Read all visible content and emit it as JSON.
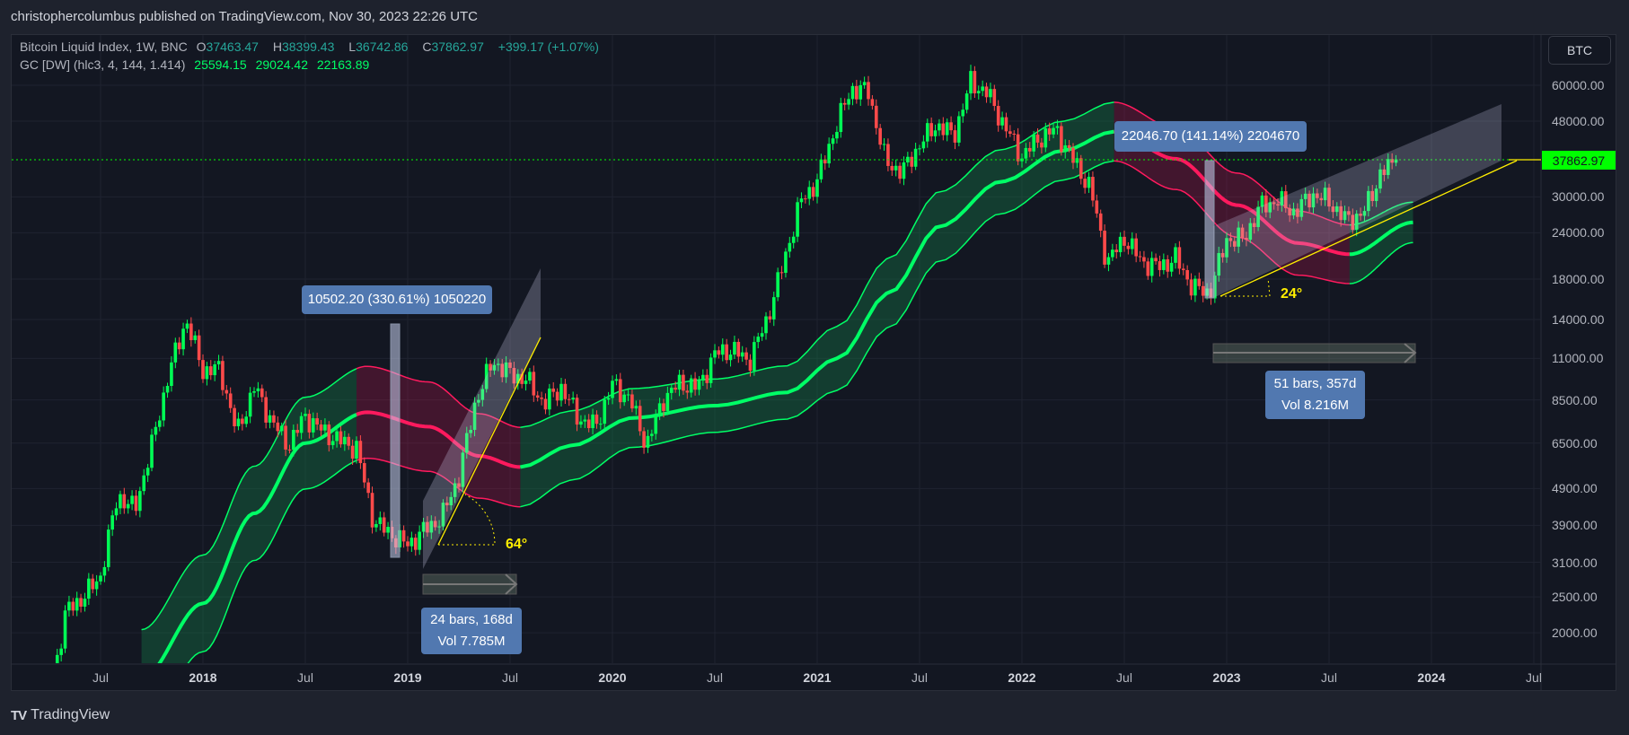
{
  "header": {
    "title": "christophercolumbus published on TradingView.com, Nov 30, 2023 22:26 UTC"
  },
  "legend": {
    "symbol": "Bitcoin Liquid Index, 1W, BNC",
    "open_label": "O",
    "open": "37463.47",
    "high_label": "H",
    "high": "38399.43",
    "low_label": "L",
    "low": "36742.86",
    "close_label": "C",
    "close": "37862.97",
    "change": "+399.17 (+1.07%)",
    "indicator": "GC [DW] (hlc3, 4, 144, 1.414)",
    "ind_values": [
      "25594.15",
      "29024.42",
      "22163.89"
    ]
  },
  "currency_button": "BTC",
  "last_price": "37862.97",
  "footer": {
    "logo": "TV",
    "brand": "TradingView"
  },
  "annotations": {
    "range1_label": "10502.20 (330.61%) 1050220",
    "range2_label": "22046.70 (141.14%) 2204670",
    "date1_bars": "24 bars, 168d",
    "date1_vol": "Vol 7.785M",
    "date2_bars": "51 bars, 357d",
    "date2_vol": "Vol 8.216M",
    "angle1": "64°",
    "angle2": "24°"
  },
  "colors": {
    "up": "#00ff55",
    "down": "#ff4a4a",
    "band_up": "#00ff66",
    "band_down": "#ff1a5e",
    "bg": "#131722"
  },
  "chart_data": {
    "type": "candlestick",
    "title": "Bitcoin Liquid Index, 1W, BNC",
    "y_scale": "log",
    "y_ticks": [
      "60000.00",
      "48000.00",
      "30000.00",
      "24000.00",
      "18000.00",
      "14000.00",
      "11000.00",
      "8500.00",
      "6500.00",
      "4900.00",
      "3900.00",
      "3100.00",
      "2500.00",
      "2000.00"
    ],
    "y_tick_values": [
      60000,
      48000,
      30000,
      24000,
      18000,
      14000,
      11000,
      8500,
      6500,
      4900,
      3900,
      3100,
      2500,
      2000
    ],
    "x_ticks": [
      {
        "t": 2017.5,
        "label": "Jul"
      },
      {
        "t": 2018,
        "label": "2018"
      },
      {
        "t": 2018.5,
        "label": "Jul"
      },
      {
        "t": 2019,
        "label": "2019"
      },
      {
        "t": 2019.5,
        "label": "Jul"
      },
      {
        "t": 2020,
        "label": "2020"
      },
      {
        "t": 2020.5,
        "label": "Jul"
      },
      {
        "t": 2021,
        "label": "2021"
      },
      {
        "t": 2021.5,
        "label": "Jul"
      },
      {
        "t": 2022,
        "label": "2022"
      },
      {
        "t": 2022.5,
        "label": "Jul"
      },
      {
        "t": 2023,
        "label": "2023"
      },
      {
        "t": 2023.5,
        "label": "Jul"
      },
      {
        "t": 2024,
        "label": "2024"
      },
      {
        "t": 2024.5,
        "label": "Jul"
      }
    ],
    "monthly_close_start": 2017.25,
    "monthly_closes": [
      1350,
      2300,
      2500,
      2850,
      4700,
      4300,
      6400,
      10000,
      14000,
      10200,
      10300,
      6900,
      9200,
      7500,
      6400,
      7700,
      7000,
      6600,
      6300,
      4000,
      3700,
      3450,
      3800,
      4100,
      5300,
      8500,
      10800,
      10000,
      9600,
      8300,
      9200,
      7600,
      7200,
      9350,
      8600,
      6400,
      8600,
      9450,
      9150,
      11300,
      11650,
      10800,
      13800,
      19700,
      29000,
      33100,
      45200,
      58800,
      57700,
      37300,
      35000,
      41500,
      47100,
      43800,
      61300,
      57000,
      46300,
      38500,
      43200,
      45500,
      37700,
      31800,
      19900,
      23300,
      20100,
      19400,
      20500,
      17100,
      16500,
      23100,
      23100,
      28400,
      29300,
      27200,
      30500,
      29200,
      25900,
      27000,
      34500,
      37863
    ],
    "gc_band": {
      "points": [
        [
          2017.7,
          1500,
          1.36
        ],
        [
          2018.0,
          2400,
          1.35
        ],
        [
          2018.25,
          4200,
          1.34
        ],
        [
          2018.5,
          6500,
          1.33
        ],
        [
          2018.8,
          7870,
          1.33
        ],
        [
          2019.1,
          7200,
          1.32
        ],
        [
          2019.35,
          6000,
          1.3
        ],
        [
          2019.55,
          5600,
          1.28
        ],
        [
          2019.8,
          6400,
          1.24
        ],
        [
          2020.1,
          7600,
          1.2
        ],
        [
          2020.5,
          8200,
          1.18
        ],
        [
          2020.85,
          8900,
          1.18
        ],
        [
          2021.1,
          11000,
          1.22
        ],
        [
          2021.35,
          16500,
          1.24
        ],
        [
          2021.6,
          25000,
          1.24
        ],
        [
          2021.9,
          33000,
          1.22
        ],
        [
          2022.2,
          40000,
          1.2
        ],
        [
          2022.45,
          45000,
          1.2
        ],
        [
          2022.75,
          38000,
          1.21
        ],
        [
          2023.05,
          28500,
          1.22
        ],
        [
          2023.35,
          22500,
          1.22
        ],
        [
          2023.6,
          21000,
          1.2
        ],
        [
          2023.91,
          25594,
          1.134
        ]
      ],
      "down_segments": [
        [
          2018.75,
          2019.55
        ],
        [
          2022.45,
          2023.6
        ]
      ]
    }
  }
}
